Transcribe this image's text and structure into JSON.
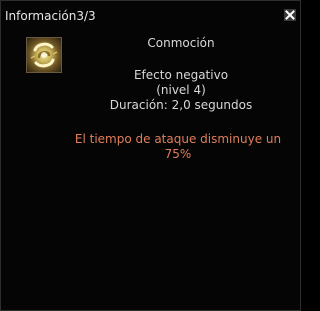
{
  "window": {
    "title": "Información3/3",
    "close_icon": "close-x-icon"
  },
  "status": {
    "icon": "concussion-swirl-icon",
    "name": "Conmoción",
    "type": "Efecto negativo",
    "level": "(nivel 4)",
    "duration": "Duración: 2,0 segundos",
    "effect_line_1": "El tiempo de ataque disminuye un",
    "effect_line_2": "75%"
  },
  "colors": {
    "background": "#050505",
    "text": "#d8d8d8",
    "effect_text": "#e07e5a",
    "icon_border": "#6b5a3e"
  }
}
